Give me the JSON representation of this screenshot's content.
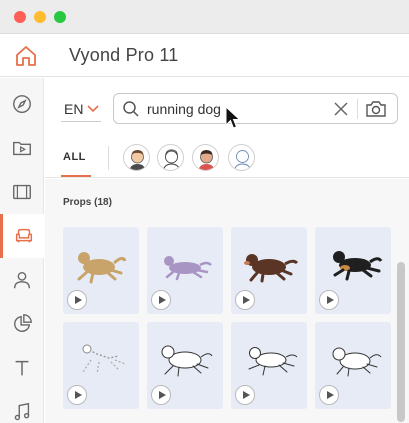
{
  "window": {
    "controls": [
      "close",
      "minimize",
      "zoom"
    ]
  },
  "header": {
    "title": "Vyond Pro 11",
    "home_icon": "home-icon"
  },
  "sidebar": {
    "items": [
      {
        "icon": "compass-icon",
        "active": false
      },
      {
        "icon": "video-folder-icon",
        "active": false
      },
      {
        "icon": "film-icon",
        "active": false
      },
      {
        "icon": "armchair-icon",
        "active": true
      },
      {
        "icon": "user-icon",
        "active": false
      },
      {
        "icon": "pie-chart-icon",
        "active": false
      },
      {
        "icon": "text-icon",
        "active": false
      },
      {
        "icon": "music-icon",
        "active": false
      }
    ]
  },
  "search": {
    "language": "EN",
    "query": "running dog",
    "icons": [
      "search-icon",
      "clear-icon",
      "camera-icon"
    ]
  },
  "tabs": {
    "all_label": "ALL",
    "avatars": [
      "character-style-1",
      "character-style-2",
      "character-style-3",
      "character-style-4"
    ]
  },
  "results": {
    "section_label": "Props (18)",
    "items": [
      {
        "color": "#c9a46a"
      },
      {
        "color": "#a995c4"
      },
      {
        "color": "#5a3526"
      },
      {
        "color": "#1f1f1f"
      },
      {
        "color": "#ffffff"
      },
      {
        "color": "#ffffff"
      },
      {
        "color": "#ffffff"
      },
      {
        "color": "#ffffff"
      }
    ]
  },
  "colors": {
    "accent": "#e5704b",
    "card_bg": "#e6ebf5"
  }
}
